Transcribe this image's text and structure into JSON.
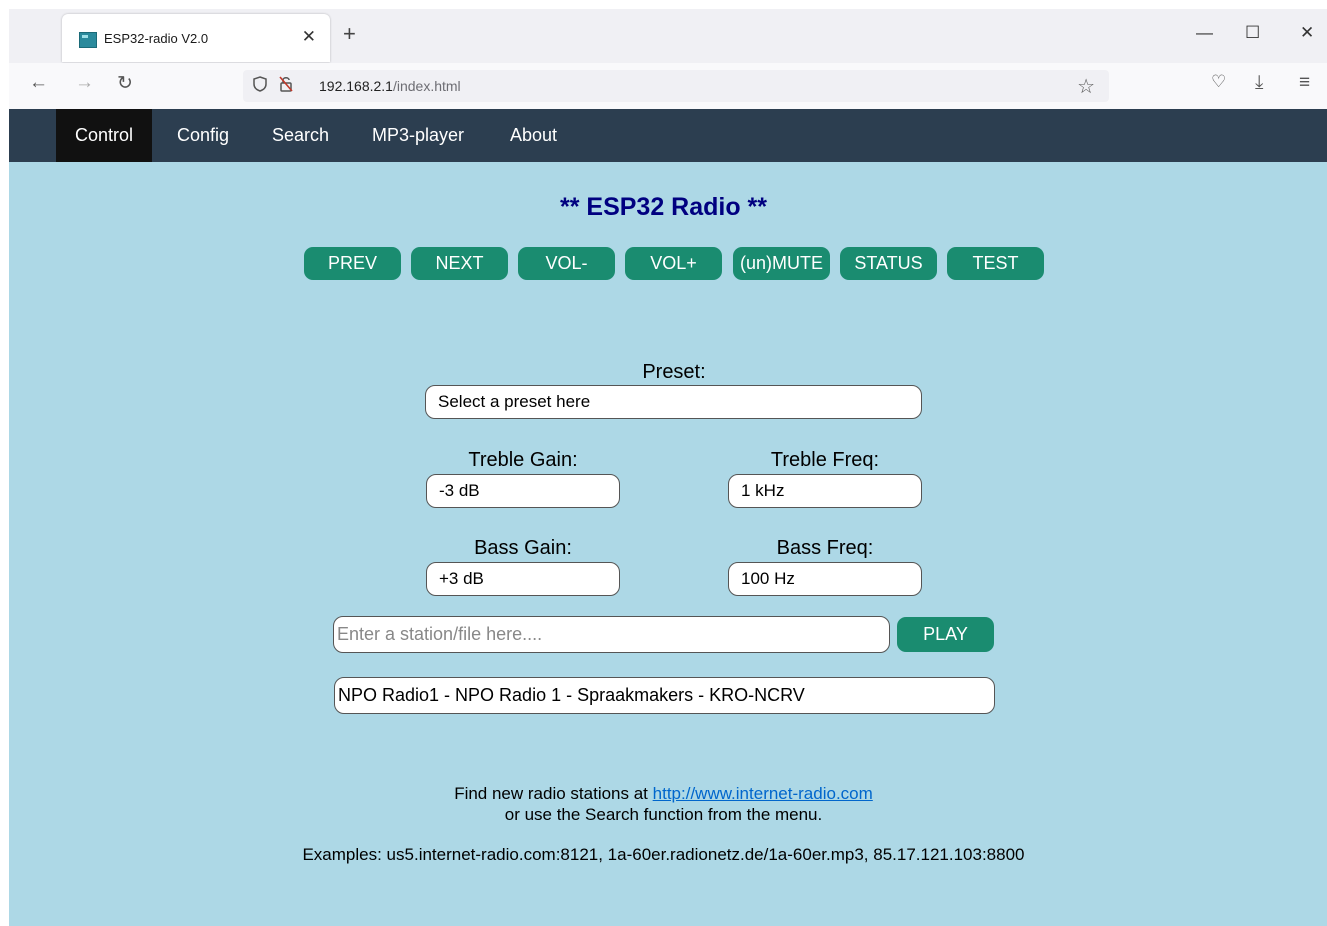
{
  "browser": {
    "tab_title": "ESP32-radio V2.0",
    "tab_close": "✕",
    "new_tab": "+",
    "window_min": "—",
    "window_max": "☐",
    "window_close": "✕",
    "back": "←",
    "forward": "→",
    "reload": "↻",
    "url_host": "192.168.2.1",
    "url_path": "/index.html",
    "pocket": "♡",
    "download": "⤓",
    "menu": "≡"
  },
  "nav": {
    "items": [
      {
        "label": "Control",
        "active": true
      },
      {
        "label": "Config"
      },
      {
        "label": "Search"
      },
      {
        "label": "MP3-player"
      },
      {
        "label": "About"
      }
    ]
  },
  "page": {
    "title": "** ESP32 Radio **",
    "buttons": [
      "PREV",
      "NEXT",
      "VOL-",
      "VOL+",
      "(un)MUTE",
      "STATUS",
      "TEST"
    ],
    "preset": {
      "label": "Preset:",
      "value": "Select a preset here"
    },
    "treble_gain": {
      "label": "Treble Gain:",
      "value": "-3 dB"
    },
    "treble_freq": {
      "label": "Treble Freq:",
      "value": "1 kHz"
    },
    "bass_gain": {
      "label": "Bass Gain:",
      "value": "+3 dB"
    },
    "bass_freq": {
      "label": "Bass Freq:",
      "value": "100 Hz"
    },
    "station_placeholder": "Enter a station/file here....",
    "play_label": "PLAY",
    "now_playing": "NPO Radio1 - NPO Radio 1 - Spraakmakers - KRO-NCRV",
    "find_text": "Find new radio stations at",
    "find_link": "http://www.internet-radio.com",
    "search_hint": "or use the Search function from the menu.",
    "examples": "Examples: us5.internet-radio.com:8121, 1a-60er.radionetz.de/1a-60er.mp3, 85.17.121.103:8800"
  },
  "colors": {
    "page_bg": "#add8e6",
    "navbar_bg": "#2c3e50",
    "button_bg": "#1a8c70",
    "title": "#000080"
  }
}
